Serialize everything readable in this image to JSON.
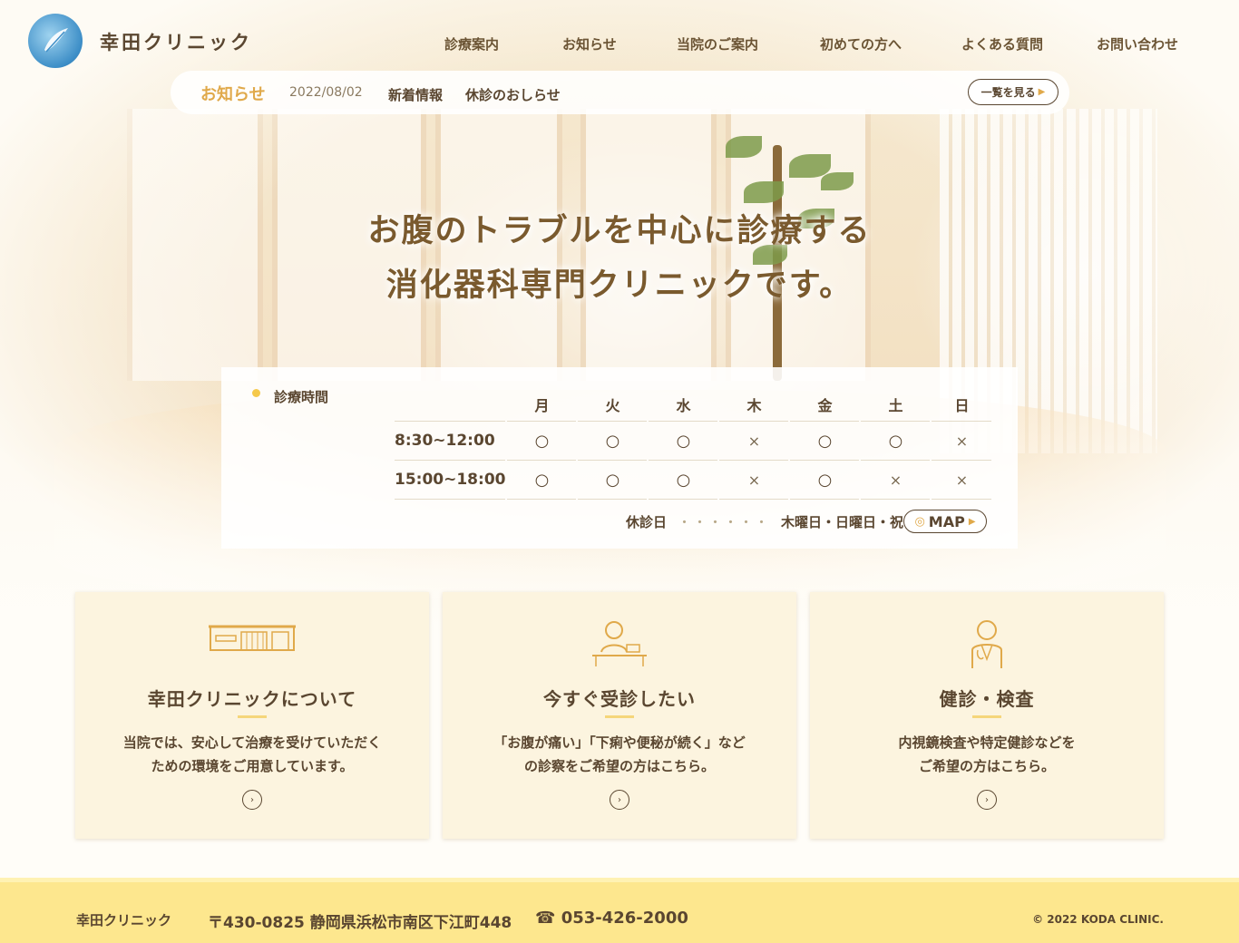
{
  "header": {
    "site_title": "幸田クリニック",
    "nav": [
      "診療案内",
      "お知らせ",
      "当院のご案内",
      "初めての方へ",
      "よくある質問",
      "お問い合わせ"
    ]
  },
  "news": {
    "label": "お知らせ",
    "date": "2022/08/02",
    "category": "新着情報",
    "title": "休診のおしらせ",
    "more_label": "一覧を見る"
  },
  "catchcopy": {
    "line1": "お腹のトラブルを中心に診療する",
    "line2": "消化器科専門クリニックです。"
  },
  "hours": {
    "title": "診療時間",
    "days": [
      "月",
      "火",
      "水",
      "木",
      "金",
      "土",
      "日"
    ],
    "rows": [
      {
        "time": "8:30~12:00",
        "marks": [
          "○",
          "○",
          "○",
          "×",
          "○",
          "○",
          "×"
        ]
      },
      {
        "time": "15:00~18:00",
        "marks": [
          "○",
          "○",
          "○",
          "×",
          "○",
          "×",
          "×"
        ]
      }
    ],
    "closed_label": "休診日",
    "closed_days": "木曜日・日曜日・祝日",
    "map_label": "MAP"
  },
  "cards": [
    {
      "title": "幸田クリニックについて",
      "desc1": "当院では、安心して治療を受けていただく",
      "desc2": "ための環境をご用意しています。",
      "icon": "clinic-building-icon"
    },
    {
      "title": "今すぐ受診したい",
      "desc1": "「お腹が痛い」「下痢や便秘が続く」など",
      "desc2": "の診察をご希望の方はこちら。",
      "icon": "reception-icon"
    },
    {
      "title": "健診・検査",
      "desc1": "内視鏡検査や特定健診などを",
      "desc2": "ご希望の方はこちら。",
      "icon": "doctor-icon"
    }
  ],
  "footer": {
    "name": "幸田クリニック",
    "address": "〒430-0825 静岡県浜松市南区下江町448",
    "tel": "053-426-2000",
    "copyright": "© 2022 KODA CLINIC."
  },
  "colors": {
    "accent": "#e0a94a",
    "footer_bg": "#fde78e",
    "card_bg": "#fcf4df",
    "text": "#5a4630"
  }
}
